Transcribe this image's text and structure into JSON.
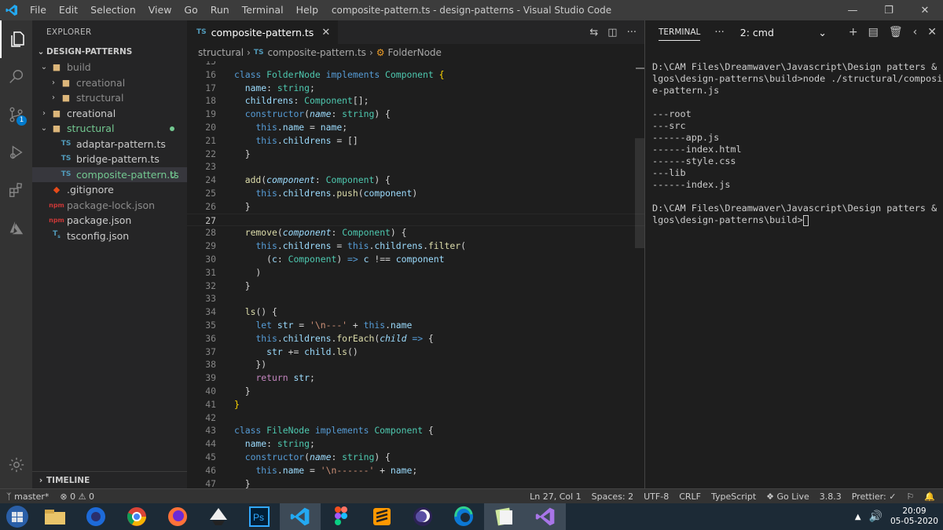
{
  "window": {
    "title": "composite-pattern.ts - design-patterns - Visual Studio Code",
    "menu": [
      "File",
      "Edit",
      "Selection",
      "View",
      "Go",
      "Run",
      "Terminal",
      "Help"
    ]
  },
  "activity_bar": {
    "items": [
      "explorer-icon",
      "search-icon",
      "source-control-icon",
      "run-debug-icon",
      "extensions-icon",
      "azure-icon"
    ],
    "source_control_badge": "1",
    "bottom": "settings-gear-icon"
  },
  "explorer": {
    "header": "EXPLORER",
    "root": "DESIGN-PATTERNS",
    "tree": [
      {
        "label": "build",
        "type": "folder-open",
        "depth": 0,
        "style": "dim"
      },
      {
        "label": "creational",
        "type": "folder",
        "depth": 1,
        "style": "dim"
      },
      {
        "label": "structural",
        "type": "folder",
        "depth": 1,
        "style": "dim"
      },
      {
        "label": "creational",
        "type": "folder",
        "depth": 0,
        "style": ""
      },
      {
        "label": "structural",
        "type": "folder-open",
        "depth": 0,
        "style": "green"
      },
      {
        "label": "adaptar-pattern.ts",
        "type": "ts",
        "depth": 1,
        "style": ""
      },
      {
        "label": "bridge-pattern.ts",
        "type": "ts",
        "depth": 1,
        "style": ""
      },
      {
        "label": "composite-pattern.ts",
        "type": "ts",
        "depth": 1,
        "style": "green",
        "status": "U"
      },
      {
        "label": ".gitignore",
        "type": "git",
        "depth": 0,
        "style": ""
      },
      {
        "label": "package-lock.json",
        "type": "npm",
        "depth": 0,
        "style": "dim"
      },
      {
        "label": "package.json",
        "type": "npm",
        "depth": 0,
        "style": ""
      },
      {
        "label": "tsconfig.json",
        "type": "tsconfig",
        "depth": 0,
        "style": ""
      }
    ],
    "timeline": "TIMELINE"
  },
  "editor": {
    "tab": "composite-pattern.ts",
    "tab_icon": "TS",
    "breadcrumb": [
      "structural",
      "composite-pattern.ts",
      "FolderNode"
    ],
    "current_line": 27,
    "lines": [
      {
        "n": "15",
        "h": ""
      },
      {
        "n": "16",
        "h": "<span class=\"kw\">class</span> <span class=\"t\">FolderNode</span> <span class=\"kw\">implements</span> <span class=\"t\">Component</span> <span class=\"b\">{</span>"
      },
      {
        "n": "17",
        "h": "  <span class=\"p\">name</span>: <span class=\"t\">string</span>;"
      },
      {
        "n": "18",
        "h": "  <span class=\"p\">childrens</span>: <span class=\"t\">Component</span>[];"
      },
      {
        "n": "19",
        "h": "  <span class=\"kw\">constructor</span>(<span class=\"i\">name</span>: <span class=\"t\">string</span>) {"
      },
      {
        "n": "20",
        "h": "    <span class=\"kw\">this</span>.<span class=\"p\">name</span> = <span class=\"p\">name</span>;"
      },
      {
        "n": "21",
        "h": "    <span class=\"kw\">this</span>.<span class=\"p\">childrens</span> = []"
      },
      {
        "n": "22",
        "h": "  }"
      },
      {
        "n": "23",
        "h": ""
      },
      {
        "n": "24",
        "h": "  <span class=\"f\">add</span>(<span class=\"i\">component</span>: <span class=\"t\">Component</span>) {"
      },
      {
        "n": "25",
        "h": "    <span class=\"kw\">this</span>.<span class=\"p\">childrens</span>.<span class=\"f\">push</span>(<span class=\"p\">component</span>)"
      },
      {
        "n": "26",
        "h": "  }"
      },
      {
        "n": "27",
        "h": ""
      },
      {
        "n": "28",
        "h": "  <span class=\"f\">remove</span>(<span class=\"i\">component</span>: <span class=\"t\">Component</span>) {"
      },
      {
        "n": "29",
        "h": "    <span class=\"kw\">this</span>.<span class=\"p\">childrens</span> = <span class=\"kw\">this</span>.<span class=\"p\">childrens</span>.<span class=\"f\">filter</span>("
      },
      {
        "n": "30",
        "h": "      (<span class=\"p\">c</span>: <span class=\"t\">Component</span>) <span class=\"kw\">=&gt;</span> <span class=\"p\">c</span> !== <span class=\"p\">component</span>"
      },
      {
        "n": "31",
        "h": "    )"
      },
      {
        "n": "32",
        "h": "  }"
      },
      {
        "n": "33",
        "h": ""
      },
      {
        "n": "34",
        "h": "  <span class=\"f\">ls</span>() {"
      },
      {
        "n": "35",
        "h": "    <span class=\"kw\">let</span> <span class=\"p\">str</span> = <span class=\"s\">'\\n---'</span> + <span class=\"kw\">this</span>.<span class=\"p\">name</span>"
      },
      {
        "n": "36",
        "h": "    <span class=\"kw\">this</span>.<span class=\"p\">childrens</span>.<span class=\"f\">forEach</span>(<span class=\"i\">child</span> <span class=\"kw\">=&gt;</span> {"
      },
      {
        "n": "37",
        "h": "      <span class=\"p\">str</span> += <span class=\"p\">child</span>.<span class=\"f\">ls</span>()"
      },
      {
        "n": "38",
        "h": "    })"
      },
      {
        "n": "39",
        "h": "    <span class=\"k\">return</span> <span class=\"p\">str</span>;"
      },
      {
        "n": "40",
        "h": "  }"
      },
      {
        "n": "41",
        "h": "<span class=\"b\">}</span>"
      },
      {
        "n": "42",
        "h": ""
      },
      {
        "n": "43",
        "h": "<span class=\"kw\">class</span> <span class=\"t\">FileNode</span> <span class=\"kw\">implements</span> <span class=\"t\">Component</span> {"
      },
      {
        "n": "44",
        "h": "  <span class=\"p\">name</span>: <span class=\"t\">string</span>;"
      },
      {
        "n": "45",
        "h": "  <span class=\"kw\">constructor</span>(<span class=\"i\">name</span>: <span class=\"t\">string</span>) {"
      },
      {
        "n": "46",
        "h": "    <span class=\"kw\">this</span>.<span class=\"p\">name</span> = <span class=\"s\">'\\n------'</span> + <span class=\"p\">name</span>;"
      },
      {
        "n": "47",
        "h": "  }"
      }
    ]
  },
  "terminal": {
    "tab": "TERMINAL",
    "selected": "2: cmd",
    "output": "D:\\CAM Files\\Dreamwaver\\Javascript\\Design patters & a\nlgos\\design-patterns\\build>node ./structural/composit\ne-pattern.js\n\n---root\n---src\n------app.js\n------index.html\n------style.css\n---lib\n------index.js\n\nD:\\CAM Files\\Dreamwaver\\Javascript\\Design patters & a\nlgos\\design-patterns\\build>"
  },
  "statusbar": {
    "branch": "master*",
    "problems": "⊗ 0 ⚠ 0",
    "position": "Ln 27, Col 1",
    "spaces": "Spaces: 2",
    "encoding": "UTF-8",
    "eol": "CRLF",
    "language": "TypeScript",
    "golive": "Go Live",
    "version": "3.8.3",
    "prettier": "Prettier: ✓"
  },
  "taskbar": {
    "apps": [
      "file-explorer-icon",
      "firefox-dev-icon",
      "chrome-icon",
      "firefox-icon",
      "inkscape-icon",
      "photoshop-icon",
      "vscode-icon",
      "figma-icon",
      "sublime-icon",
      "eclipse-icon",
      "edge-icon",
      "notepad-icon",
      "visual-studio-icon"
    ],
    "time": "20:09",
    "date": "05-05-2020"
  },
  "colors": {
    "accent": "#007acc",
    "untracked": "#73c991"
  }
}
